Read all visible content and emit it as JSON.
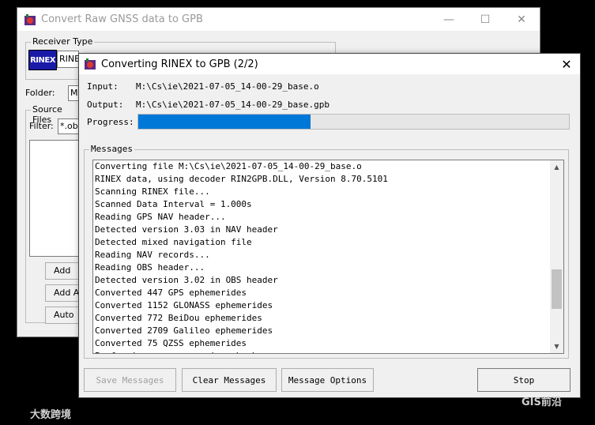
{
  "back_window": {
    "title": "Convert Raw GNSS data to GPB",
    "minimize": "—",
    "maximize": "☐",
    "close": "✕",
    "receiver_type_label": "Receiver Type",
    "rinex_logo": "RINEX",
    "receiver_value": "RINE",
    "folder_label": "Folder:",
    "folder_value": "M",
    "source_files_label": "Source Files",
    "filter_label": "Filter:",
    "filter_value": "*.obs",
    "buttons": [
      "Add",
      "Add Al",
      "Auto"
    ]
  },
  "dialog": {
    "title": "Converting RINEX to GPB (2/2)",
    "close": "✕",
    "input_label": "Input:",
    "input_value": "M:\\Cs\\ie\\2021-07-05_14-00-29_base.o",
    "output_label": "Output:",
    "output_value": "M:\\Cs\\ie\\2021-07-05_14-00-29_base.gpb",
    "progress_label": "Progress:",
    "progress_fraction": 0.4,
    "messages_label": "Messages",
    "messages": [
      "Converting file M:\\Cs\\ie\\2021-07-05_14-00-29_base.o",
      "RINEX data, using decoder RIN2GPB.DLL, Version 8.70.5101",
      "Scanning RINEX file...",
      "Scanned Data Interval = 1.000s",
      "Reading GPS NAV header...",
      "Detected version 3.03 in NAV header",
      "Detected mixed navigation file",
      "Reading NAV records...",
      "Reading OBS header...",
      "Detected version 3.02 in OBS header",
      "Converted 447 GPS ephemerides",
      "Converted 1152 GLONASS ephemerides",
      "Converted 772 BeiDou ephemerides",
      "Converted 2709 Galileo ephemerides",
      "Converted 75 QZSS ephemerides",
      "Performing pre-processing checks..."
    ],
    "scroll_up": "▲",
    "scroll_down": "▼",
    "save_messages": "Save Messages",
    "clear_messages": "Clear Messages",
    "message_options": "Message Options",
    "stop": "Stop"
  },
  "watermarks": {
    "left": "大数跨境",
    "right": "GIS前沿"
  }
}
